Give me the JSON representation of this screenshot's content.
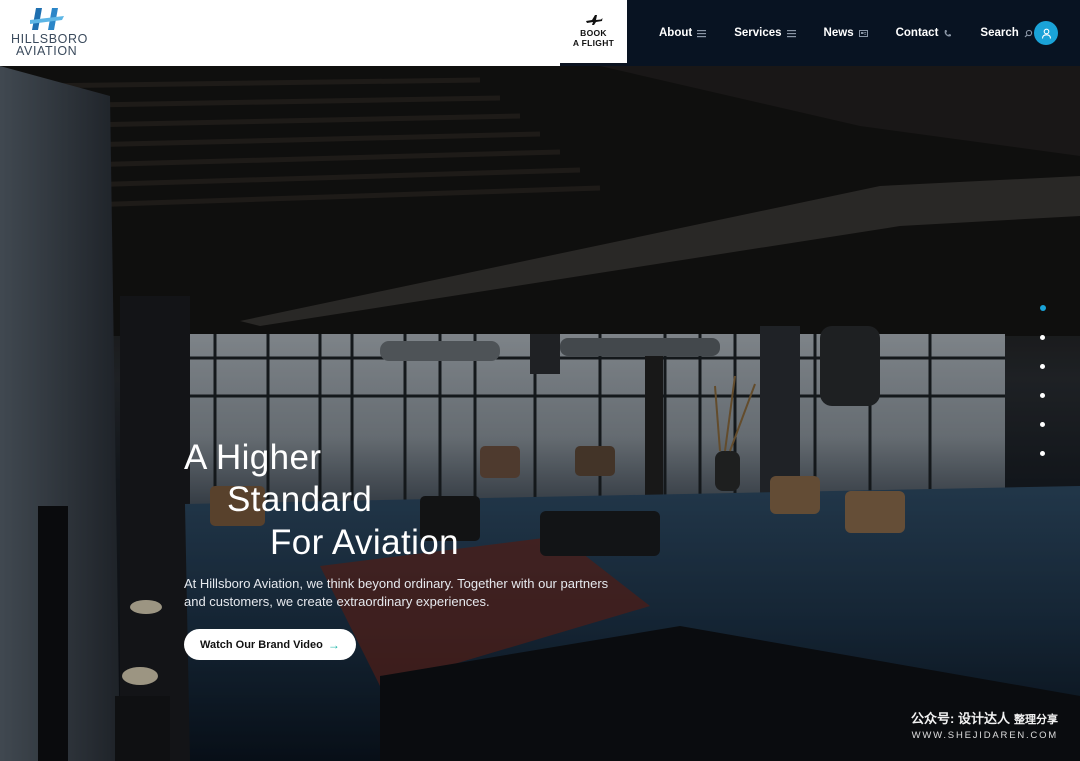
{
  "brand": {
    "name_line1": "HILLSBORO",
    "name_line2": "AVIATION",
    "accent": "#1aa3d8",
    "logo_icon": "h-wing-logo-icon"
  },
  "book": {
    "line1": "BOOK",
    "line2": "A FLIGHT",
    "icon": "airplane-icon"
  },
  "nav": {
    "items": [
      {
        "label": "About",
        "icon": "menu-lines-icon"
      },
      {
        "label": "Services",
        "icon": "menu-lines-icon"
      },
      {
        "label": "News",
        "icon": "newspaper-icon"
      },
      {
        "label": "Contact",
        "icon": "phone-icon"
      },
      {
        "label": "Search",
        "icon": "search-icon"
      }
    ],
    "user_icon": "user-icon"
  },
  "hero": {
    "headline_line1": "A Higher",
    "headline_line2": "Standard",
    "headline_line3": "For Aviation",
    "description": "At Hillsboro Aviation, we think beyond ordinary. Together with our partners and customers, we create extraordinary experiences.",
    "cta_label": "Watch Our Brand Video",
    "cta_icon": "arrow-right-icon",
    "slides_total": 6,
    "slide_active": 1
  },
  "watermark": {
    "title": "公众号: 设计达人",
    "subtitle": "整理分享",
    "url": "WWW.SHEJIDAREN.COM"
  }
}
